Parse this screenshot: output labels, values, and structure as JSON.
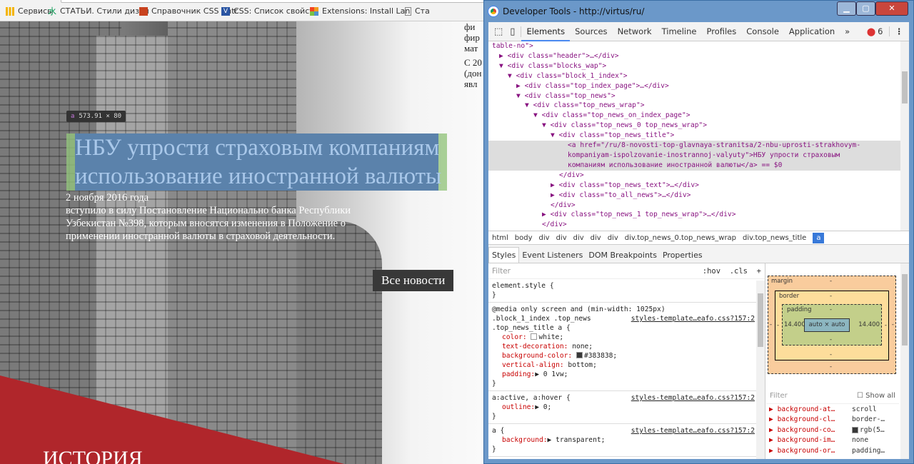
{
  "bookmarks": [
    {
      "label": "Сервисы",
      "icon": "apps-grid-icon",
      "color": "#f4b400"
    },
    {
      "label": "СТАТЬИ. Стили дизай",
      "icon": "bookmark-favicon-icon",
      "color": "#0f9d58"
    },
    {
      "label": "Справочник CSS | htr",
      "icon": "htmlbook-favicon-icon",
      "color": "#c8421e"
    },
    {
      "label": "CSS: Список свойств",
      "icon": "v-favicon-icon",
      "color": "#2a55a3"
    },
    {
      "label": "Extensions: Install Lan",
      "icon": "joomla-favicon-icon",
      "color": "#f29b1f"
    },
    {
      "label": "Ста",
      "icon": "page-icon",
      "color": "#888"
    }
  ],
  "page": {
    "right_text": [
      "фи",
      "фир",
      "мат",
      "С 20",
      "(дон",
      "явл"
    ],
    "inspect_tooltip": {
      "tag": "a",
      "size": "573.91 × 80"
    },
    "news_title": "НБУ упрости страховым компаниям использование иностранной валюты",
    "news_date": "2 ноября 2016 года",
    "news_text": "вступило в силу Постановление Национально банка Республики Узбекистан №398, которым вносятся изменения в Положение о применении иностранной валюты в страховой деятельности.",
    "all_news": "Все новости",
    "history": "ИСТОРИЯ"
  },
  "devtools": {
    "window_title": "Developer Tools - http://virtus/ru/",
    "tabs": [
      "Elements",
      "Sources",
      "Network",
      "Timeline",
      "Profiles",
      "Console",
      "Application",
      "»"
    ],
    "error_count": "6",
    "dom": {
      "l0": "table-no\">",
      "l1": "<div class=\"header\">…</div>",
      "l2": "<div class=\"blocks_wap\">",
      "l3": "<div class=\"block_1_index\">",
      "l4": "<div class=\"top_index_page\">…</div>",
      "l5": "<div class=\"top_news\">",
      "l6": "<div class=\"top_news_wrap\">",
      "l7": "<div class=\"top_news_on_index_page\">",
      "l8": "<div class=\"top_news_0 top_news_wrap\">",
      "l9": "<div class=\"top_news_title\">",
      "l10a": "<a href=\"/ru/8-novosti-top-glavnaya-stranitsa/2-nbu-uprosti-strakhovym-",
      "l10b": "kompaniyam-ispolzovanie-inostrannoj-valyuty\">НБУ упрости страховым",
      "l10c": "компаниям использование иностранной валюты</a> == $0",
      "l11": "</div>",
      "l12": "<div class=\"top_news_text\">…</div>",
      "l13": "<div class=\"to_all_news\">…</div>",
      "l14": "</div>",
      "l15": "<div class=\"top_news_1 top_news_wrap\">…</div>",
      "l16": "</div>"
    },
    "breadcrumb": [
      "html",
      "body",
      "div",
      "div",
      "div",
      "div",
      "div",
      "div.top_news_0.top_news_wrap",
      "div.top_news_title",
      "a"
    ],
    "subtabs": [
      "Styles",
      "Event Listeners",
      "DOM Breakpoints",
      "Properties"
    ],
    "styles": {
      "filter": "Filter",
      "hov": ":hov",
      "cls": ".cls",
      "plus": "+",
      "r1": "element.style {",
      "close": "}",
      "r2_media": "@media only screen and (min-width: 1025px)",
      "r2_sel1": ".block_1_index .top_news",
      "r2_sel2": ".top_news_title a {",
      "src": "styles-template…eafo.css?157:2",
      "p_color": "color:",
      "v_color": "white;",
      "p_td": "text-decoration:",
      "v_td": "none;",
      "p_bg": "background-color:",
      "v_bg": "#383838;",
      "p_va": "vertical-align:",
      "v_va": "bottom;",
      "p_pad": "padding:",
      "v_pad": "▶ 0 1vw;",
      "r3": "a:active, a:hover {",
      "p_out": "outline:",
      "v_out": "▶ 0;",
      "r4": "a {",
      "p_bgr": "background:",
      "v_bgr": "▶ transparent;"
    },
    "boxmodel": {
      "margin": "margin",
      "border": "border",
      "padding": "padding",
      "dash": "-",
      "left": "14.400",
      "right": "14.400",
      "content": "auto × auto"
    },
    "computed": {
      "filter": "Filter",
      "show_all": "Show all",
      "rows": [
        [
          "background-at…",
          "scroll"
        ],
        [
          "background-cl…",
          "border-…"
        ],
        [
          "background-co…",
          "rgb(5…"
        ],
        [
          "background-im…",
          "none"
        ],
        [
          "background-or…",
          "padding…"
        ]
      ]
    }
  }
}
